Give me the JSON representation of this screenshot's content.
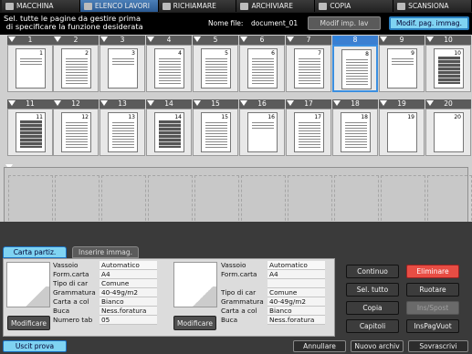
{
  "top_tabs": [
    {
      "label": "MACCHINA",
      "icon": "machine-icon",
      "active": false
    },
    {
      "label": "ELENCO LAVORI",
      "icon": "job-list-icon",
      "active": true
    },
    {
      "label": "RICHIAMARE",
      "icon": "recall-icon",
      "active": false
    },
    {
      "label": "ARCHIVIARE",
      "icon": "store-icon",
      "active": false
    },
    {
      "label": "COPIA",
      "icon": "copy-icon",
      "active": false
    },
    {
      "label": "SCANSIONA",
      "icon": "scan-icon",
      "active": false
    }
  ],
  "header": {
    "instruction": "Sel. tutte le pagine da gestire prima\n di specificare la funzione desiderata",
    "file_label": "Nome file:",
    "file_name": "document_01",
    "btn_modif_imp": "Modif imp. lav",
    "btn_modif_pag": "Modif. pag. immag."
  },
  "pages": [
    {
      "n": "1",
      "style": "sparse"
    },
    {
      "n": "2",
      "style": "lines"
    },
    {
      "n": "3",
      "style": "sparse"
    },
    {
      "n": "4",
      "style": "lines"
    },
    {
      "n": "5",
      "style": "lines"
    },
    {
      "n": "6",
      "style": "lines"
    },
    {
      "n": "7",
      "style": "lines"
    },
    {
      "n": "8",
      "style": "lines",
      "selected": true
    },
    {
      "n": "9",
      "style": "sparse"
    },
    {
      "n": "10",
      "style": "dark"
    },
    {
      "n": "11",
      "style": "dark"
    },
    {
      "n": "12",
      "style": "lines"
    },
    {
      "n": "13",
      "style": "lines"
    },
    {
      "n": "14",
      "style": "dark"
    },
    {
      "n": "15",
      "style": "lines"
    },
    {
      "n": "16",
      "style": "sparse"
    },
    {
      "n": "17",
      "style": "lines"
    },
    {
      "n": "18",
      "style": "lines"
    },
    {
      "n": "19",
      "style": "blank"
    },
    {
      "n": "20",
      "style": "blank"
    }
  ],
  "tabs": {
    "carta": "Carta partiz.",
    "inserire": "Inserire immag."
  },
  "left_settings": [
    {
      "k": "Vassoio",
      "v": "Automatico"
    },
    {
      "k": "Form.carta",
      "v": "A4"
    },
    {
      "k": "Tipo di car",
      "v": "Comune"
    },
    {
      "k": "Grammatura",
      "v": "40-49g/m2"
    },
    {
      "k": "Carta a col",
      "v": "Bianco"
    },
    {
      "k": "Buca",
      "v": "Ness.foratura"
    },
    {
      "k": "Numero tab",
      "v": "05"
    }
  ],
  "right_settings": [
    {
      "k": "Vassoio",
      "v": "Automatico"
    },
    {
      "k": "Form.carta",
      "v": "A4"
    },
    {
      "k": "",
      "v": ""
    },
    {
      "k": "Tipo di car",
      "v": "Comune"
    },
    {
      "k": "Grammatura",
      "v": "40-49g/m2"
    },
    {
      "k": "Carta a col",
      "v": "Bianco"
    },
    {
      "k": "Buca",
      "v": "Ness.foratura"
    }
  ],
  "modify_label": "Modificare",
  "actions": {
    "continuo": "Continuo",
    "eliminare": "Eliminare",
    "sel_tutto": "Sel. tutto",
    "ruotare": "Ruotare",
    "copia": "Copia",
    "ins_spost": "Ins/Spost",
    "capitoli": "Capitoli",
    "ins_pag_vuot": "InsPagVuot"
  },
  "footer": {
    "uscit": "Uscit prova",
    "annullare": "Annullare",
    "nuovo": "Nuovo archiv",
    "sovrascrivi": "Sovrascrivi"
  },
  "colors": {
    "accent": "#7fd3f2",
    "active_tab": "#2b5a92",
    "danger": "#e84d44",
    "selection": "#3b8fe0"
  }
}
